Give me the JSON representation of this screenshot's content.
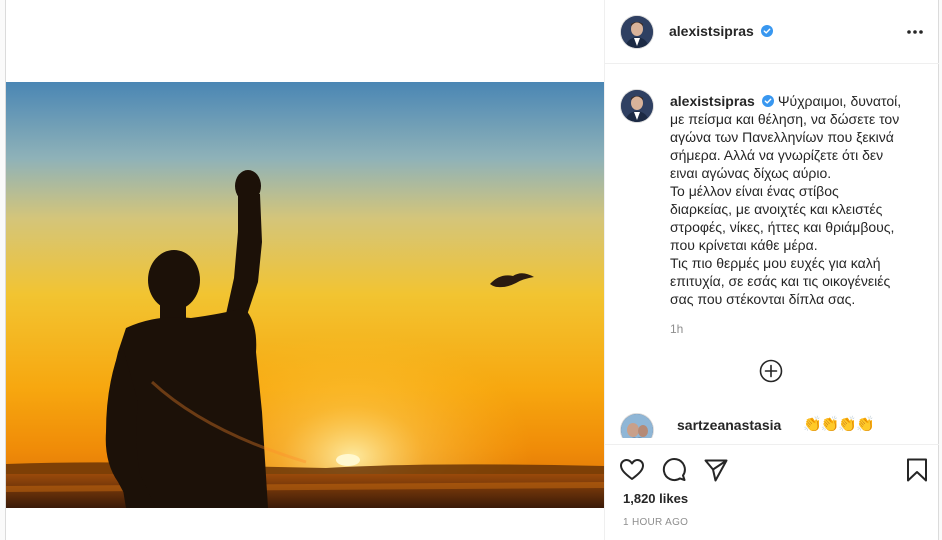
{
  "post": {
    "author": "alexistsipras",
    "verified": true,
    "caption_lines": [
      "Ψύχραιμοι, δυνατοί,",
      "με πείσμα και θέληση, να δώσετε τον",
      "αγώνα των Πανελληνίων που ξεκινά",
      "σήμερα. Αλλά να γνωρίζετε ότι δεν",
      "ειναι αγώνας δίχως αύριο.",
      "Το μέλλον είναι ένας στίβος",
      "διαρκείας, με ανοιχτές και κλειστές",
      "στροφές, νίκες, ήττες και θριάμβους,",
      "που κρίνεται κάθε μέρα.",
      "Τις πιο θερμές μου ευχές για καλή",
      "επιτυχία, σε εσάς και τις οικογένειές",
      "σας που στέκονται δίπλα σας."
    ],
    "caption_age": "1h",
    "likes": "1,820 likes",
    "time_ago": "1 HOUR AGO"
  },
  "comment": {
    "username": "sartzeanastasia",
    "text": "👏👏👏👏"
  },
  "colors": {
    "verified_badge": "#3897f0",
    "secondary_text": "#8e8e8e",
    "border": "#dbdbdb"
  },
  "icons": {
    "header_more": "more-horizontal-icon",
    "load_comments": "plus-circle-icon",
    "like": "heart-icon",
    "comment": "comment-bubble-icon",
    "share": "paper-plane-icon",
    "save": "bookmark-icon"
  }
}
